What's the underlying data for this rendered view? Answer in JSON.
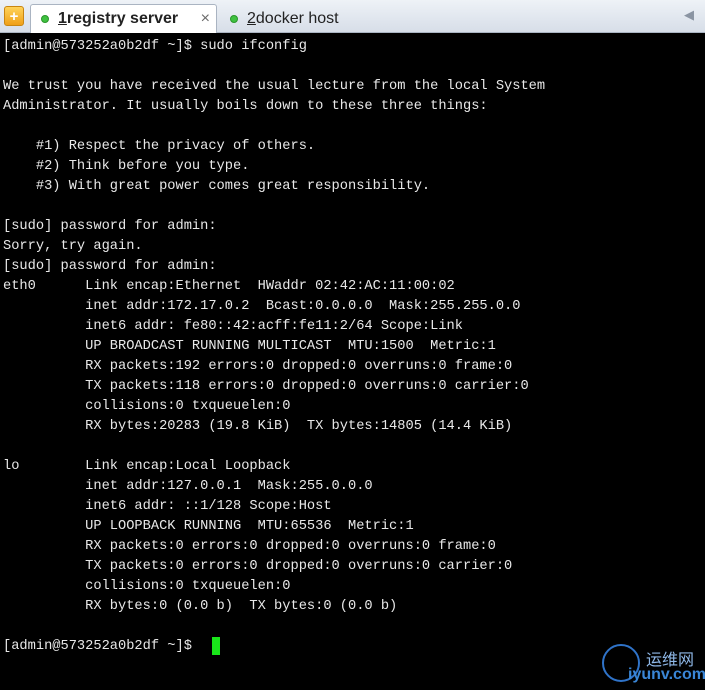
{
  "tabbar": {
    "new_tab_icon": "plus-icon",
    "tabs": [
      {
        "number": "1",
        "title": " registry server",
        "status_color": "#3fc140",
        "close_symbol": "×"
      },
      {
        "number": "2",
        "title": " docker host",
        "status_color": "#3fc140"
      }
    ],
    "scroll_symbol": "◀"
  },
  "terminal": {
    "lines": [
      "[admin@573252a0b2df ~]$ sudo ifconfig",
      "",
      "We trust you have received the usual lecture from the local System",
      "Administrator. It usually boils down to these three things:",
      "",
      "    #1) Respect the privacy of others.",
      "    #2) Think before you type.",
      "    #3) With great power comes great responsibility.",
      "",
      "[sudo] password for admin:",
      "Sorry, try again.",
      "[sudo] password for admin:",
      "eth0      Link encap:Ethernet  HWaddr 02:42:AC:11:00:02",
      "          inet addr:172.17.0.2  Bcast:0.0.0.0  Mask:255.255.0.0",
      "          inet6 addr: fe80::42:acff:fe11:2/64 Scope:Link",
      "          UP BROADCAST RUNNING MULTICAST  MTU:1500  Metric:1",
      "          RX packets:192 errors:0 dropped:0 overruns:0 frame:0",
      "          TX packets:118 errors:0 dropped:0 overruns:0 carrier:0",
      "          collisions:0 txqueuelen:0",
      "          RX bytes:20283 (19.8 KiB)  TX bytes:14805 (14.4 KiB)",
      "",
      "lo        Link encap:Local Loopback",
      "          inet addr:127.0.0.1  Mask:255.0.0.0",
      "          inet6 addr: ::1/128 Scope:Host",
      "          UP LOOPBACK RUNNING  MTU:65536  Metric:1",
      "          RX packets:0 errors:0 dropped:0 overruns:0 frame:0",
      "          TX packets:0 errors:0 dropped:0 overruns:0 carrier:0",
      "          collisions:0 txqueuelen:0",
      "          RX bytes:0 (0.0 b)  TX bytes:0 (0.0 b)",
      "",
      "[admin@573252a0b2df ~]$ "
    ],
    "cursor_color": "#19e61a",
    "text_color": "#e8e8e8",
    "background_color": "#000000"
  },
  "watermark": {
    "text_cn": "运维网",
    "text_en": "iyunv.com"
  }
}
